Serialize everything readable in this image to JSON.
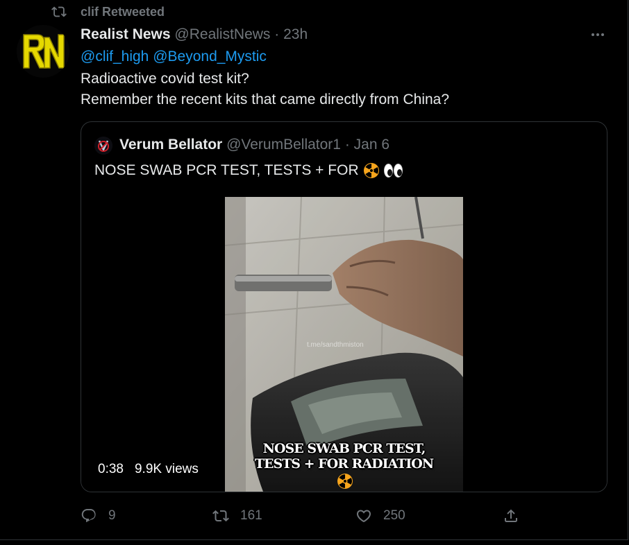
{
  "retweet": {
    "label": "clif Retweeted",
    "icon": "retweet-icon"
  },
  "tweet": {
    "avatar_text": "RN",
    "name": "Realist News",
    "handle": "@RealistNews",
    "separator": "·",
    "time": "23h",
    "mentions": "@clif_high @Beyond_Mystic",
    "text_lines": [
      "Radioactive covid test kit?",
      "Remember the recent kits that came directly from China?"
    ]
  },
  "quote": {
    "name": "Verum Bellator",
    "handle": "@VerumBellator1",
    "separator": "·",
    "time": "Jan 6",
    "text": "NOSE SWAB PCR TEST, TESTS + FOR",
    "video": {
      "caption_line1": "NOSE SWAB PCR TEST,",
      "caption_line2": "TESTS + FOR RADIATION",
      "watermark": "t.me/sandthmiston",
      "duration": "0:38",
      "views": "9.9K views"
    }
  },
  "actions": {
    "replies": "9",
    "retweets": "161",
    "likes": "250"
  },
  "colors": {
    "background": "#000000",
    "link": "#1d9bf0",
    "muted": "#71767b",
    "avatar_accent": "#e5d800"
  }
}
